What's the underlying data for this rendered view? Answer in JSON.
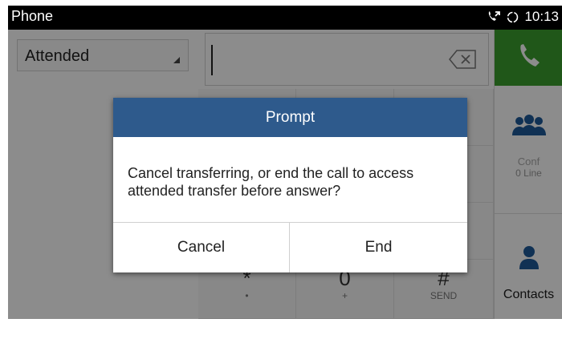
{
  "status_bar": {
    "app_title": "Phone",
    "time": "10:13",
    "icons": [
      "call-forward-icon",
      "sync-icon"
    ]
  },
  "dialer": {
    "mode_dropdown": {
      "selected": "Attended"
    },
    "number_input": {
      "value": ""
    },
    "keys": [
      {
        "main": "*",
        "sub": "•"
      },
      {
        "main": "0",
        "sub": "+"
      },
      {
        "main": "#",
        "sub": "SEND"
      }
    ]
  },
  "side_panel": {
    "call_button": {
      "icon": "phone-handset-icon"
    },
    "conf": {
      "label": "Conf",
      "sub": "0 Line",
      "icon": "conference-icon"
    },
    "contacts": {
      "label": "Contacts",
      "icon": "contact-person-icon"
    }
  },
  "dialog": {
    "title": "Prompt",
    "message": "Cancel transferring, or end the call to access attended transfer before answer?",
    "buttons": {
      "cancel": "Cancel",
      "end": "End"
    }
  },
  "colors": {
    "status_bar": "#000000",
    "dialog_header": "#2e5a8c",
    "call_button": "#3b9e2f",
    "contact_icon": "#1e5a99"
  }
}
